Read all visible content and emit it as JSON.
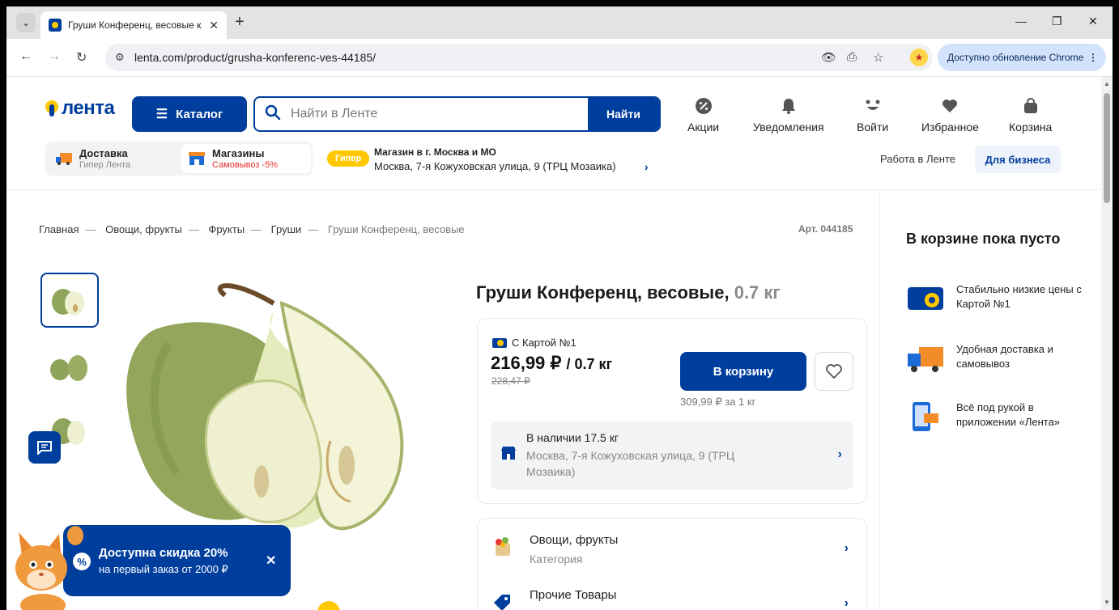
{
  "browser": {
    "tab_title": "Груши Конференц, весовые к",
    "url": "lenta.com/product/grusha-konferenc-ves-44185/",
    "update_label": "Доступно обновление Chrome"
  },
  "header": {
    "logo": "лента",
    "catalog_label": "Каталог",
    "search_placeholder": "Найти в Ленте",
    "search_button": "Найти",
    "nav": [
      {
        "label": "Акции",
        "icon": "percent-icon"
      },
      {
        "label": "Уведомления",
        "icon": "bell-icon"
      },
      {
        "label": "Войти",
        "icon": "smile-icon"
      },
      {
        "label": "Избранное",
        "icon": "heart-icon"
      },
      {
        "label": "Корзина",
        "icon": "bag-icon"
      }
    ],
    "delivery": {
      "title": "Доставка",
      "sub": "Гипер Лента"
    },
    "stores": {
      "title": "Магазины",
      "sub": "Самовывоз -5%"
    },
    "store_badge": "Гипер",
    "store_title": "Магазин в г. Москва и МО",
    "store_address": "Москва, 7-я Кожуховская улица, 9 (ТРЦ Мозаика)",
    "work_link": "Работа в Ленте",
    "business_button": "Для бизнеса"
  },
  "breadcrumbs": [
    "Главная",
    "Овощи, фрукты",
    "Фрукты",
    "Груши",
    "Груши Конференц, весовые"
  ],
  "article": "Арт. 044185",
  "product": {
    "title": "Груши Конференц, весовые,",
    "weight": "0.7 кг",
    "card_label": "С Картой №1",
    "price": "216,99 ₽",
    "price_per": "/ 0.7 кг",
    "old_price": "228,47 ₽",
    "regular_price": "309,99 ₽ за 1 кг",
    "cart_button": "В корзину",
    "stock_title": "В наличии 17.5 кг",
    "stock_address": "Москва, 7-я Кожуховская улица, 9 (ТРЦ Мозаика)"
  },
  "categories": [
    {
      "title": "Овощи, фрукты",
      "sub": "Категория"
    },
    {
      "title": "Прочие Товары",
      "sub": ""
    }
  ],
  "cart": {
    "empty_title": "В корзине пока пусто",
    "benefits": [
      "Стабильно низкие цены с Картой №1",
      "Удобная доставка и самовывоз",
      "Всё под рукой в приложении «Лента»"
    ]
  },
  "promo": {
    "title": "Доступна скидка 20%",
    "sub": "на первый заказ от 2000 ₽"
  },
  "colors": {
    "brand_blue": "#003e9e",
    "brand_yellow": "#ffc800",
    "accent_red": "#e32b2b"
  }
}
